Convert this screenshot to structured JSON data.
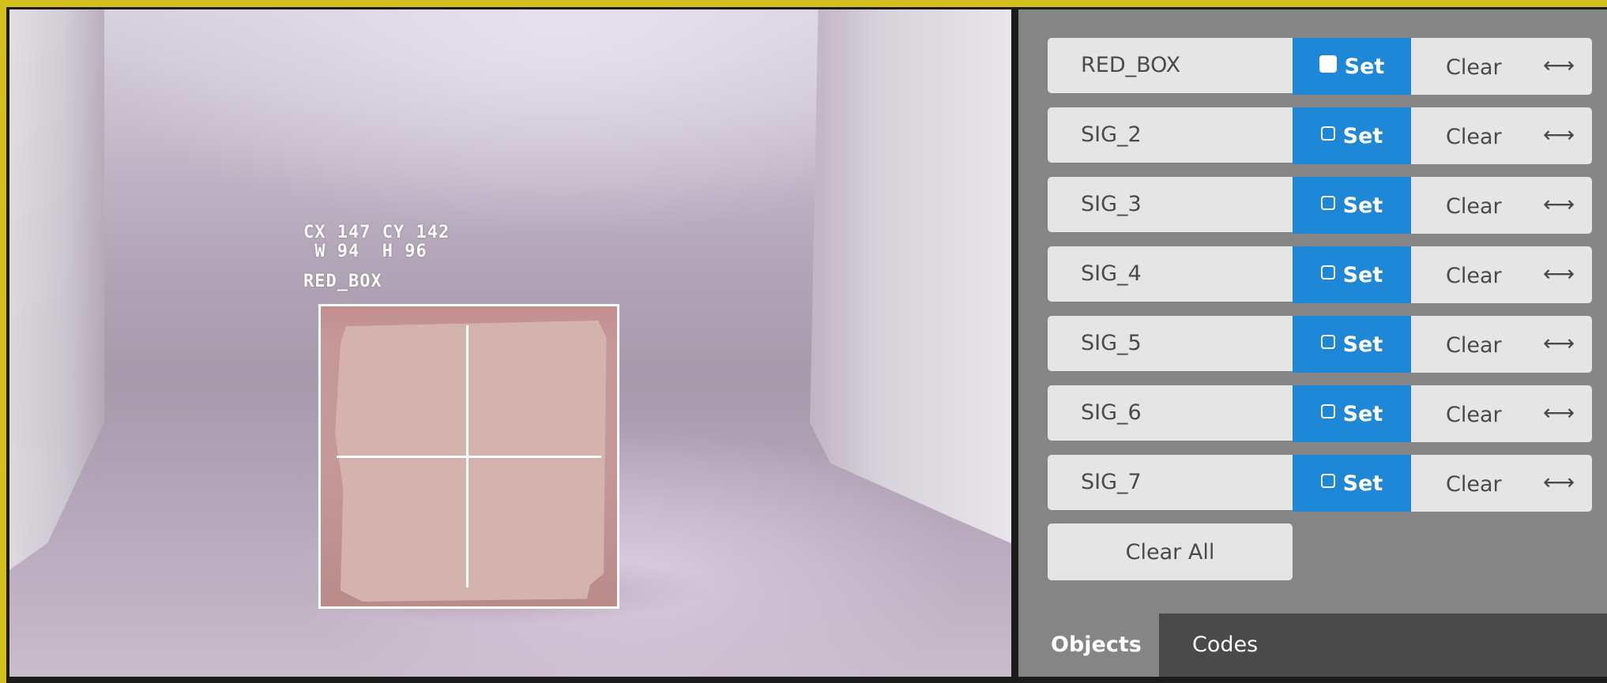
{
  "camera": {
    "overlay_coords": "CX 147 CY 142",
    "overlay_size": " W 94  H 96",
    "detected_label": "RED_BOX"
  },
  "signatures": [
    {
      "name": "RED_BOX",
      "set_label": "Set",
      "set_checked": true,
      "clear_label": "Clear",
      "icon": "left-right-arrow-icon"
    },
    {
      "name": "SIG_2",
      "set_label": "Set",
      "set_checked": false,
      "clear_label": "Clear",
      "icon": "left-right-arrow-icon"
    },
    {
      "name": "SIG_3",
      "set_label": "Set",
      "set_checked": false,
      "clear_label": "Clear",
      "icon": "left-right-arrow-icon"
    },
    {
      "name": "SIG_4",
      "set_label": "Set",
      "set_checked": false,
      "clear_label": "Clear",
      "icon": "left-right-arrow-icon"
    },
    {
      "name": "SIG_5",
      "set_label": "Set",
      "set_checked": false,
      "clear_label": "Clear",
      "icon": "left-right-arrow-icon"
    },
    {
      "name": "SIG_6",
      "set_label": "Set",
      "set_checked": false,
      "clear_label": "Clear",
      "icon": "left-right-arrow-icon"
    },
    {
      "name": "SIG_7",
      "set_label": "Set",
      "set_checked": false,
      "clear_label": "Clear",
      "icon": "left-right-arrow-icon"
    }
  ],
  "clear_all_label": "Clear All",
  "tabs": [
    {
      "label": "Objects",
      "active": true
    },
    {
      "label": "Codes",
      "active": false
    }
  ],
  "colors": {
    "set_button": "#1e88d6",
    "panel_bg": "#858585",
    "button_bg": "#e5e5e5",
    "tab_bar": "#4a4a4a",
    "frame_accent": "#d2bf1e"
  }
}
